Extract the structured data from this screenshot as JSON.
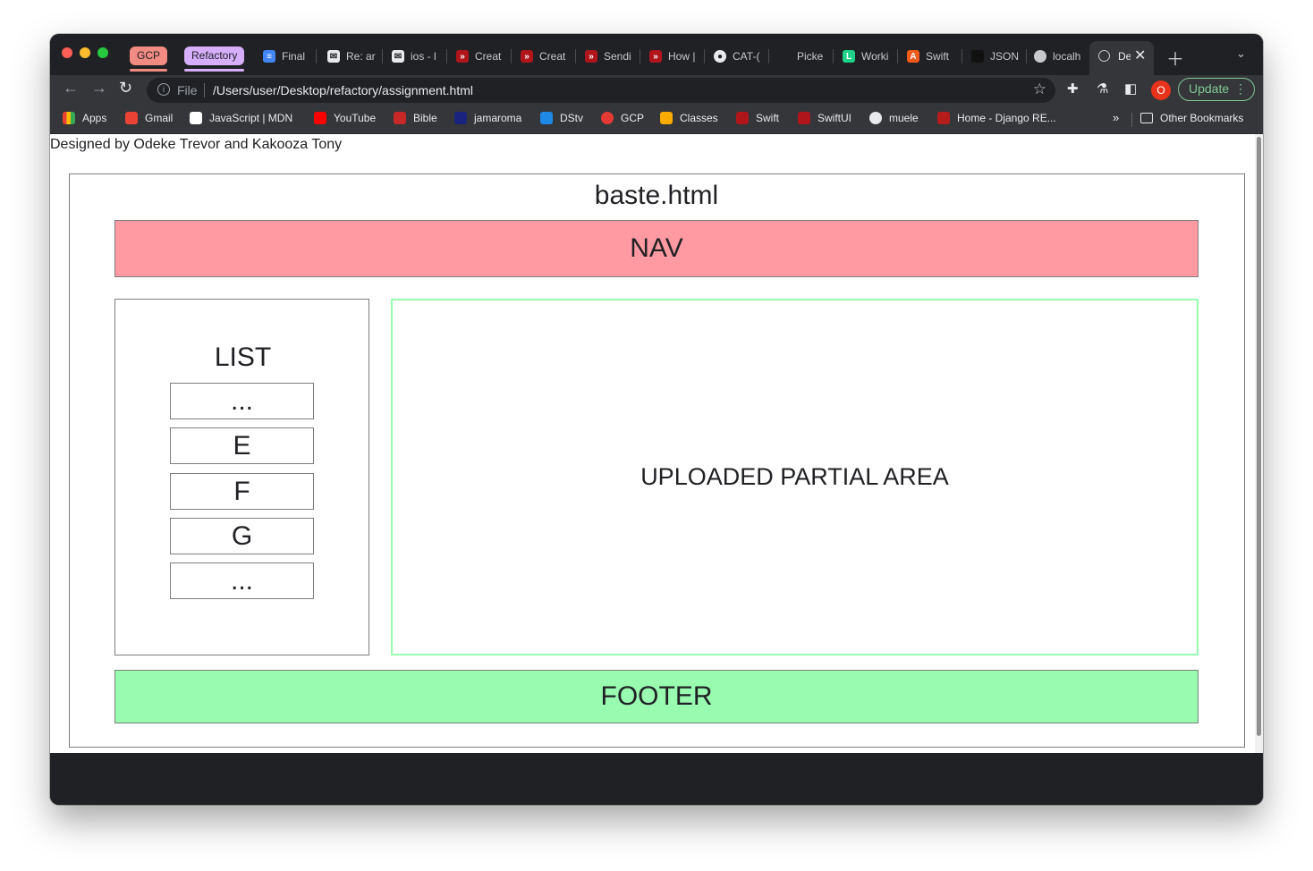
{
  "browser": {
    "tab_groups": [
      {
        "label": "GCP",
        "color": "#f28b82"
      },
      {
        "label": "Refactory",
        "color": "#d7aefb"
      }
    ],
    "tabs": [
      {
        "label": "Final",
        "icon": "google-docs-icon"
      },
      {
        "label": "Re: ar",
        "icon": "mail-icon"
      },
      {
        "label": "ios - l",
        "icon": "mail-icon"
      },
      {
        "label": "Creat",
        "icon": "swift-icon"
      },
      {
        "label": "Creat",
        "icon": "swift-icon"
      },
      {
        "label": "Sendi",
        "icon": "swift-icon"
      },
      {
        "label": "How |",
        "icon": "swift-icon"
      },
      {
        "label": "CAT-(",
        "icon": "github-icon"
      },
      {
        "label": "Picke",
        "icon": "apple-icon"
      },
      {
        "label": "Worki",
        "icon": "l-icon"
      },
      {
        "label": "Swift",
        "icon": "a-icon"
      },
      {
        "label": "JSON",
        "icon": "json-icon"
      },
      {
        "label": "localh",
        "icon": "globe-icon"
      }
    ],
    "active_tab": {
      "label": "De",
      "icon": "globe-icon"
    },
    "address": {
      "scheme_label": "File",
      "url": "/Users/user/Desktop/refactory/assignment.html"
    },
    "profile_initial": "O",
    "update_label": "Update",
    "bookmarks": [
      {
        "label": "Apps",
        "icon": "apps-grid-icon"
      },
      {
        "label": "Gmail",
        "icon": "gmail-icon"
      },
      {
        "label": "JavaScript | MDN",
        "icon": "mdn-icon"
      },
      {
        "label": "YouTube",
        "icon": "youtube-icon"
      },
      {
        "label": "Bible",
        "icon": "bible-icon"
      },
      {
        "label": "jamaroma",
        "icon": "jamaroma-icon"
      },
      {
        "label": "DStv",
        "icon": "dstv-icon"
      },
      {
        "label": "GCP",
        "icon": "gcp-icon"
      },
      {
        "label": "Classes",
        "icon": "classroom-icon"
      },
      {
        "label": "Swift",
        "icon": "swift-icon"
      },
      {
        "label": "SwiftUI",
        "icon": "swift-icon"
      },
      {
        "label": "muele",
        "icon": "globe-icon"
      },
      {
        "label": "Home - Django RE...",
        "icon": "django-icon"
      }
    ],
    "bookmarks_more": "»",
    "other_bookmarks": "Other Bookmarks"
  },
  "page": {
    "credit": "Designed by Odeke Trevor and Kakooza Tony",
    "title": "baste.html",
    "nav_label": "NAV",
    "list_title": "LIST",
    "list_items": [
      "...",
      "E",
      "F",
      "G",
      "..."
    ],
    "upload_label": "UPLOADED PARTIAL AREA",
    "footer_label": "FOOTER"
  },
  "colors": {
    "nav": "#ff9aa2",
    "footer": "#98fbb0",
    "upload_border": "#98fbb0",
    "chrome_dark": "#202124",
    "update_accent": "#81c995"
  }
}
